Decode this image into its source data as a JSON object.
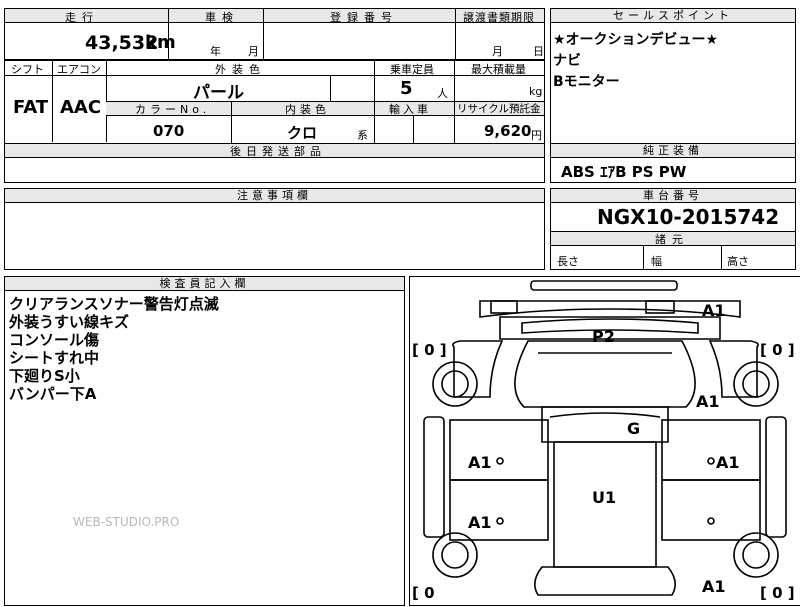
{
  "top": {
    "h_mileage": "走行",
    "h_inspection": "車検",
    "h_reg": "登録番号",
    "h_transfer": "譲渡書類期限",
    "mileage_val": "43,532",
    "mileage_unit": "km",
    "insp_year": "年",
    "insp_month": "月",
    "tr_month": "月",
    "tr_day": "日"
  },
  "row2": {
    "h_shift": "シフト",
    "h_aircon": "エアコン",
    "h_color": "外装色",
    "h_capacity": "乗車定員",
    "h_load": "最大積載量",
    "shift": "FAT",
    "aircon": "AAC",
    "color": "パール",
    "capacity": "5",
    "capacity_unit": "人",
    "load_unit": "kg",
    "h_colorno": "カラーNo.",
    "h_interior": "内装色",
    "h_import": "輸入車",
    "h_recycle": "リサイクル預託金",
    "colorno": "070",
    "interior": "クロ",
    "interior_unit": "系",
    "recycle": "9,620",
    "recycle_unit": "円",
    "h_later": "後日発送部品"
  },
  "sales": {
    "header": "セールスポイント",
    "lines": [
      "★オークションデビュー★",
      "ナビ",
      "Bモニター"
    ]
  },
  "equip": {
    "header": "純正装備",
    "value": "ABS ｴｱB PS PW"
  },
  "notes": {
    "header": "注意事項欄"
  },
  "chassis": {
    "header": "車台番号",
    "value": "NGX10-2015742",
    "h_dims": "諸元",
    "length": "長さ",
    "width": "幅",
    "height": "高さ"
  },
  "inspector": {
    "header": "検査員記入欄",
    "lines": [
      "クリアランスソナー警告灯点滅",
      "外装うすい線キズ",
      "コンソール傷",
      "シートすれ中",
      "下廻りS小",
      "バンパー下A"
    ],
    "watermark": "WEB-STUDIO.PRO"
  },
  "diagram": {
    "marks": {
      "a1_top_right": "A1",
      "p2": "P2",
      "a1_right_upper": "A1",
      "g": "G",
      "a1_left_front_door": "A1",
      "a1_right_front_door": "A1",
      "u1": "U1",
      "a1_left_rear_door": "A1",
      "a1_bottom_right": "A1"
    },
    "brackets": {
      "upper_left": "[ 0 ]",
      "upper_right": "[ 0 ]",
      "lower_left": "[ 0",
      "lower_right": "[ 0 ]"
    }
  }
}
